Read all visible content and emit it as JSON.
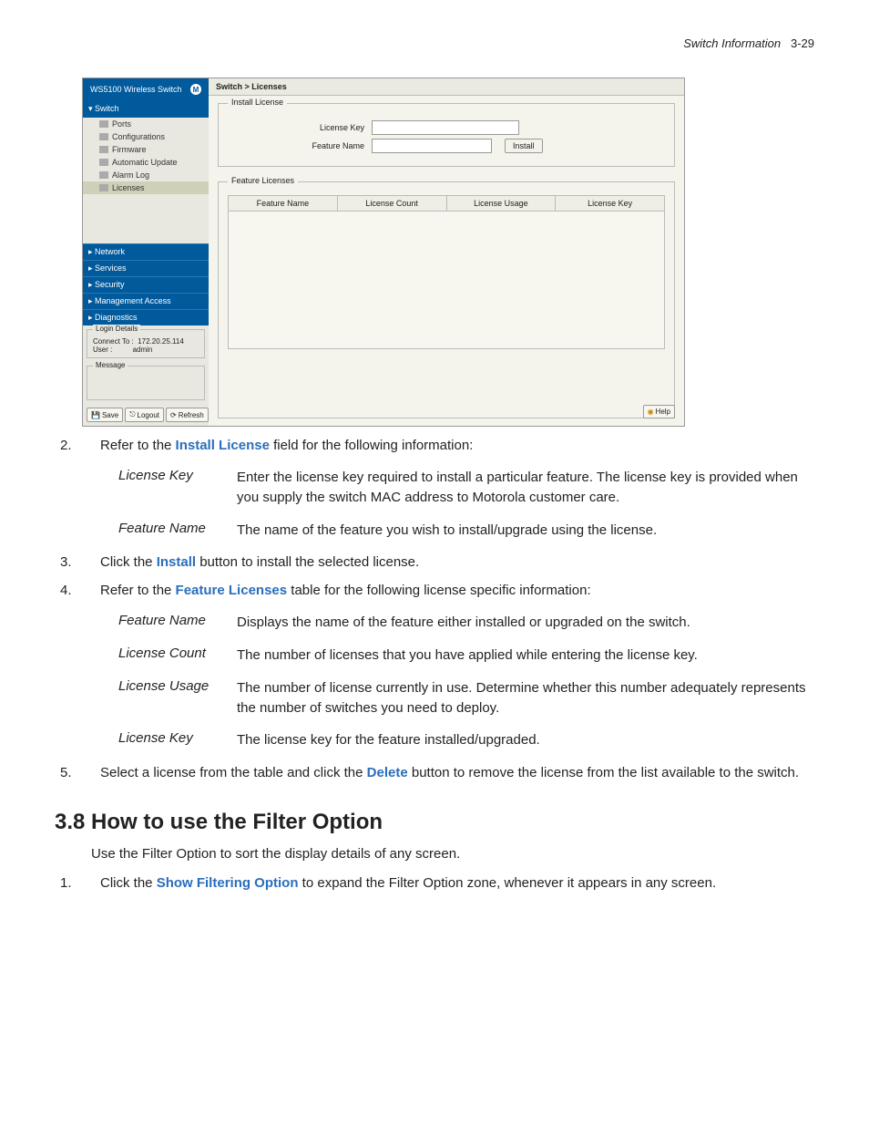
{
  "header": {
    "chapter_title": "Switch Information",
    "page_num": "3-29"
  },
  "screenshot": {
    "product_title": "WS5100 Wireless Switch",
    "nav": {
      "open_group": "Switch",
      "items": [
        "Ports",
        "Configurations",
        "Firmware",
        "Automatic Update",
        "Alarm Log",
        "Licenses"
      ],
      "collapsed": [
        "Network",
        "Services",
        "Security",
        "Management Access",
        "Diagnostics"
      ]
    },
    "login": {
      "legend": "Login Details",
      "connect_label": "Connect To :",
      "connect_value": "172.20.25.114",
      "user_label": "User :",
      "user_value": "admin"
    },
    "message_legend": "Message",
    "buttons": {
      "save": "Save",
      "logout": "Logout",
      "refresh": "Refresh"
    },
    "breadcrumb": "Switch > Licenses",
    "install_license": {
      "legend": "Install License",
      "license_key_label": "License Key",
      "feature_name_label": "Feature Name",
      "install_btn": "Install"
    },
    "feature_licenses": {
      "legend": "Feature Licenses",
      "cols": [
        "Feature Name",
        "License Count",
        "License Usage",
        "License Key"
      ]
    },
    "help_btn": "Help"
  },
  "doc": {
    "step2": "Refer to the ",
    "step2_link": "Install License",
    "step2_tail": " field for the following information:",
    "defs1": [
      {
        "term": "License Key",
        "def": "Enter the license key required to install a particular feature. The license key is provided when you supply the switch MAC address to Motorola customer care."
      },
      {
        "term": "Feature Name",
        "def": "The name of the feature you wish to install/upgrade using the license."
      }
    ],
    "step3_a": "Click the ",
    "step3_link": "Install",
    "step3_b": " button to install the selected license.",
    "step4_a": "Refer to the ",
    "step4_link": "Feature Licenses",
    "step4_b": " table for the following license specific information:",
    "defs2": [
      {
        "term": "Feature Name",
        "def": "Displays the name of the feature either installed or upgraded on the switch."
      },
      {
        "term": "License Count",
        "def": "The number of licenses that you have applied while entering the license key."
      },
      {
        "term": "License Usage",
        "def": "The number of license currently in use. Determine whether this number adequately represents the number of switches you need to deploy."
      },
      {
        "term": "License Key",
        "def": "The license key for the feature installed/upgraded."
      }
    ],
    "step5_a": "Select a license from the table and click the ",
    "step5_link": "Delete",
    "step5_b": " button to remove the license from the list available to the switch.",
    "section_heading": "3.8 How to use the Filter Option",
    "section_p1": "Use the Filter Option to sort the display details of any screen.",
    "section_step1_a": "Click the ",
    "section_step1_link": "Show Filtering Option",
    "section_step1_b": " to expand the Filter Option zone, whenever it appears in any screen."
  }
}
